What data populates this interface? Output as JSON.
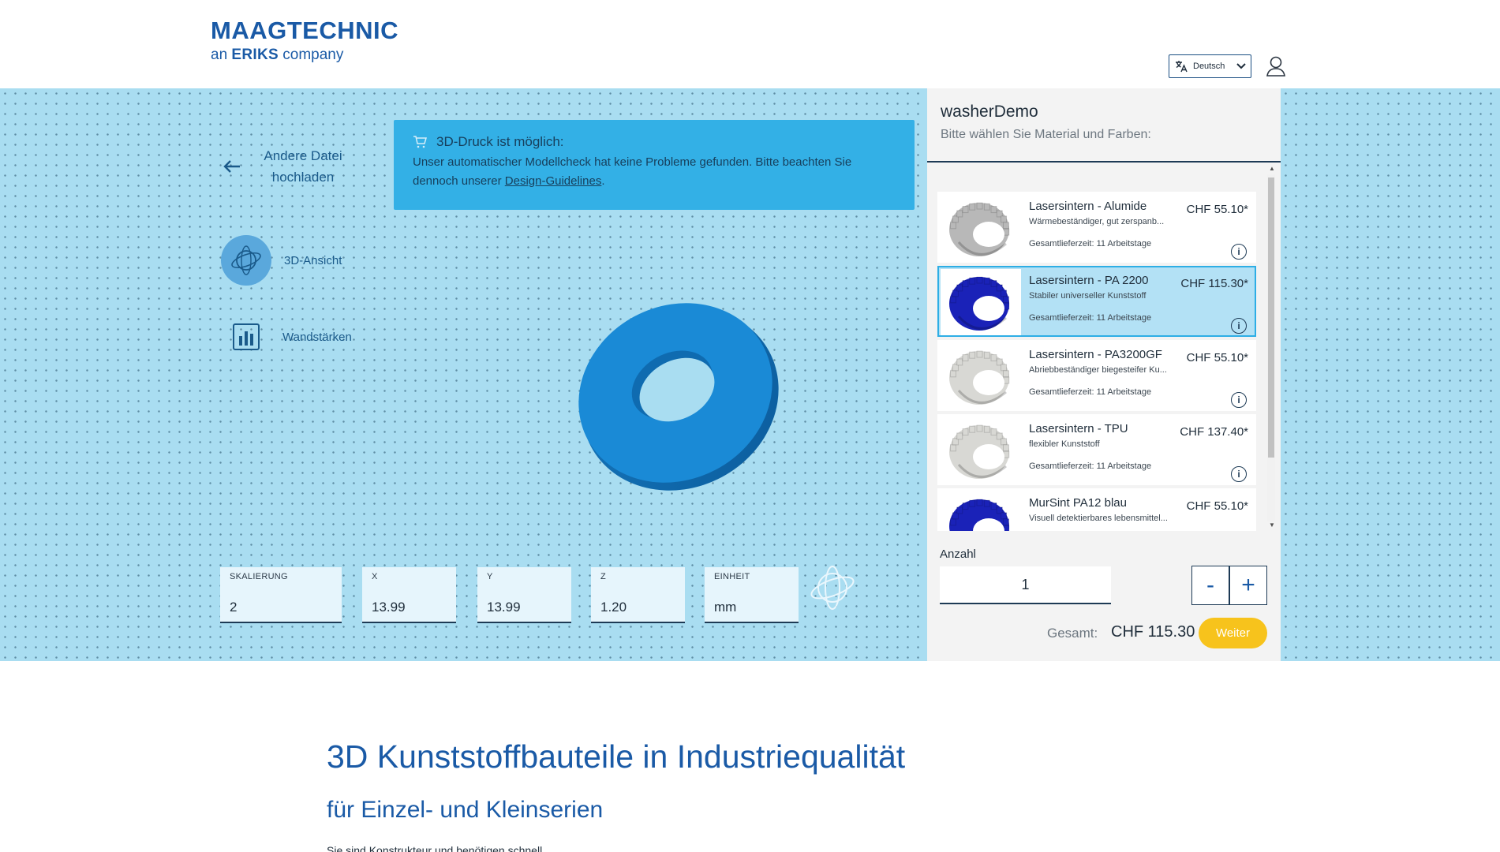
{
  "header": {
    "logo_main": "MAAGTECHNIC",
    "logo_sub_prefix": "an",
    "logo_sub_brand": "ERIKS",
    "logo_sub_suffix": "company",
    "language": "Deutsch"
  },
  "viewer": {
    "back_line1": "Andere Datei",
    "back_line2": "hochladen",
    "view_3d": "3D-Ansicht",
    "wall_thickness": "Wandstärken",
    "notice_title": "3D-Druck ist möglich:",
    "notice_body": "Unser automatischer Modellcheck hat keine Probleme gefunden. Bitte beachten Sie dennoch unserer",
    "notice_link": "Design-Guidelines",
    "notice_end": ".",
    "fields": [
      {
        "label": "SKALIERUNG",
        "value": "2"
      },
      {
        "label": "X",
        "value": "13.99"
      },
      {
        "label": "Y",
        "value": "13.99"
      },
      {
        "label": "Z",
        "value": "1.20"
      },
      {
        "label": "EINHEIT",
        "value": "mm"
      }
    ],
    "model_color": "#1a8ad6"
  },
  "panel": {
    "file_name": "washerDemo",
    "subtitle": "Bitte wählen Sie Material und Farben:",
    "materials": [
      {
        "name": "Lasersintern - Alumide",
        "desc": "Wärmebeständiger, gut zerspanb...",
        "time": "Gesamtlieferzeit: 11 Arbeitstage",
        "price": "CHF 55.10*",
        "color": "#b8b8b8"
      },
      {
        "name": "Lasersintern - PA 2200",
        "desc": "Stabiler universeller Kunststoff",
        "time": "Gesamtlieferzeit: 11 Arbeitstage",
        "price": "CHF 115.30*",
        "color": "#1a22b8"
      },
      {
        "name": "Lasersintern - PA3200GF",
        "desc": "Abriebbeständiger biegesteifer Ku...",
        "time": "Gesamtlieferzeit: 11 Arbeitstage",
        "price": "CHF 55.10*",
        "color": "#d8d8d4"
      },
      {
        "name": "Lasersintern - TPU",
        "desc": "flexibler Kunststoff",
        "time": "Gesamtlieferzeit: 11 Arbeitstage",
        "price": "CHF 137.40*",
        "color": "#d8d8d4"
      },
      {
        "name": "MurSint PA12 blau",
        "desc": "Visuell detektierbares lebensmittel...",
        "time": "",
        "price": "CHF 55.10*",
        "color": "#1a22b8"
      }
    ],
    "qty_label": "Anzahl",
    "qty_value": "1",
    "minus": "-",
    "plus": "+",
    "total_label": "Gesamt:",
    "total_value": "CHF 115.30",
    "next": "Weiter"
  },
  "content": {
    "heading": "3D Kunststoffbauteile in Industriequalität",
    "subheading": "für Einzel- und Kleinserien",
    "paragraph": "Sie sind Konstrukteur und benötigen schnell"
  }
}
